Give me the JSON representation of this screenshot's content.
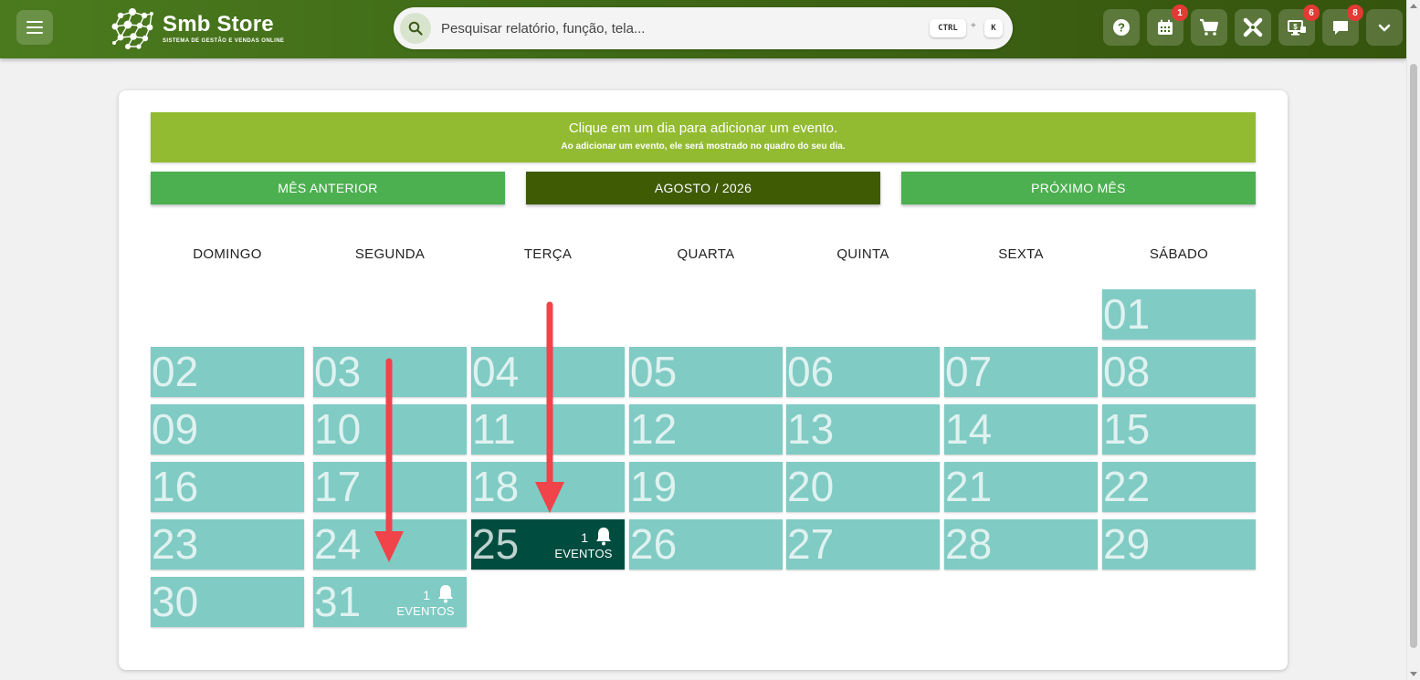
{
  "header": {
    "brand_name": "Smb Store",
    "brand_tagline": "SISTEMA DE GESTÃO E VENDAS ONLINE",
    "search_placeholder": "Pesquisar relatório, função, tela...",
    "shortcut_ctrl": "CTRL",
    "shortcut_plus": "+",
    "shortcut_key": "K",
    "buttons": [
      {
        "name": "help-button",
        "icon": "help-circle-icon",
        "badge": ""
      },
      {
        "name": "calendar-button",
        "icon": "calendar-icon",
        "badge": "1"
      },
      {
        "name": "cart-button",
        "icon": "cart-icon",
        "badge": ""
      },
      {
        "name": "tools-button",
        "icon": "tools-icon",
        "badge": ""
      },
      {
        "name": "monitor-button",
        "icon": "monitor-dollar-icon",
        "badge": "6"
      },
      {
        "name": "messages-button",
        "icon": "chat-icon",
        "badge": "8"
      },
      {
        "name": "user-menu-button",
        "icon": "chevron-down-icon",
        "badge": ""
      }
    ]
  },
  "calendar": {
    "info_title": "Clique em um dia para adicionar um evento.",
    "info_subtitle": "Ao adicionar um evento, ele será mostrado no quadro do seu dia.",
    "prev_label": "MÊS ANTERIOR",
    "current_label": "AGOSTO / 2026",
    "next_label": "PRÓXIMO MÊS",
    "weekdays": [
      "DOMINGO",
      "SEGUNDA",
      "TERÇA",
      "QUARTA",
      "QUINTA",
      "SEXTA",
      "SÁBADO"
    ],
    "first_weekday_index": 6,
    "days": [
      "01",
      "02",
      "03",
      "04",
      "05",
      "06",
      "07",
      "08",
      "09",
      "10",
      "11",
      "12",
      "13",
      "14",
      "15",
      "16",
      "17",
      "18",
      "19",
      "20",
      "21",
      "22",
      "23",
      "24",
      "25",
      "26",
      "27",
      "28",
      "29",
      "30",
      "31"
    ],
    "events": [
      {
        "day": "25",
        "count": "1",
        "label": "EVENTOS",
        "style": "dark"
      },
      {
        "day": "31",
        "count": "1",
        "label": "EVENTOS",
        "style": "light"
      }
    ]
  },
  "colors": {
    "header_green": "#3f6a17",
    "banner_green": "#93bb32",
    "nav_green": "#4caf50",
    "current_month": "#3f5b04",
    "day_teal": "#80cbc4",
    "event_dark": "#004d40",
    "badge_red": "#e53935",
    "arrow_red": "#f0434a"
  }
}
